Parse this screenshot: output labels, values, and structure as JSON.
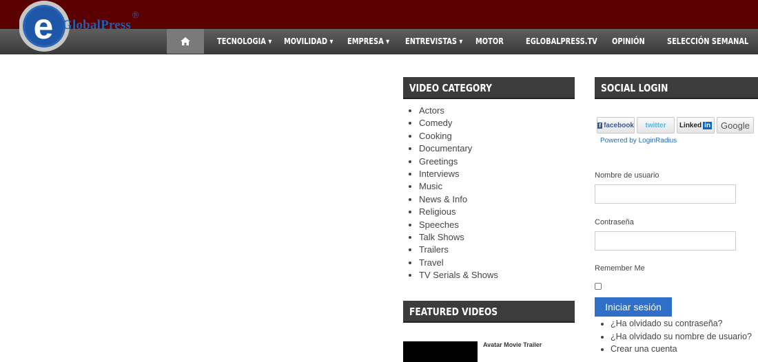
{
  "brand": {
    "name": "GlobalPress",
    "letter": "e",
    "registered": "®",
    "colors": {
      "header": "#5a0000",
      "nav": "#4a4a4a",
      "accent": "#2f6fc8"
    }
  },
  "nav": {
    "home_icon": "home-icon",
    "items": [
      "TECNOLOGIA",
      "MOVILIDAD",
      "EMPRESA",
      "ENTREVISTAS",
      "MOTOR",
      "EGLOBALPRESS.TV",
      "OPINIÓN",
      "SELECCIÓN SEMANAL"
    ],
    "dropdown_marker": "▾"
  },
  "video_category": {
    "title": "VIDEO CATEGORY",
    "items": [
      "Actors",
      "Comedy",
      "Cooking",
      "Documentary",
      "Greetings",
      "Interviews",
      "Music",
      "News & Info",
      "Religious",
      "Speeches",
      "Talk Shows",
      "Trailers",
      "Travel",
      "TV Serials & Shows"
    ]
  },
  "featured_videos": {
    "title": "FEATURED VIDEOS",
    "first_title": "Avatar Movie Trailer"
  },
  "social_login": {
    "title": "SOCIAL LOGIN",
    "providers": {
      "facebook": "facebook",
      "twitter": "twitter",
      "linkedin": "Linked",
      "linkedin_in": "in",
      "google": "Google"
    },
    "powered_by": "Powered by LoginRadius"
  },
  "login_form": {
    "username_label": "Nombre de usuario",
    "password_label": "Contraseña",
    "remember_label": "Remember Me",
    "submit_label": "Iniciar sesión",
    "links": [
      "¿Ha olvidado su contraseña?",
      "¿Ha olvidado su nombre de usuario?",
      "Crear una cuenta"
    ]
  }
}
